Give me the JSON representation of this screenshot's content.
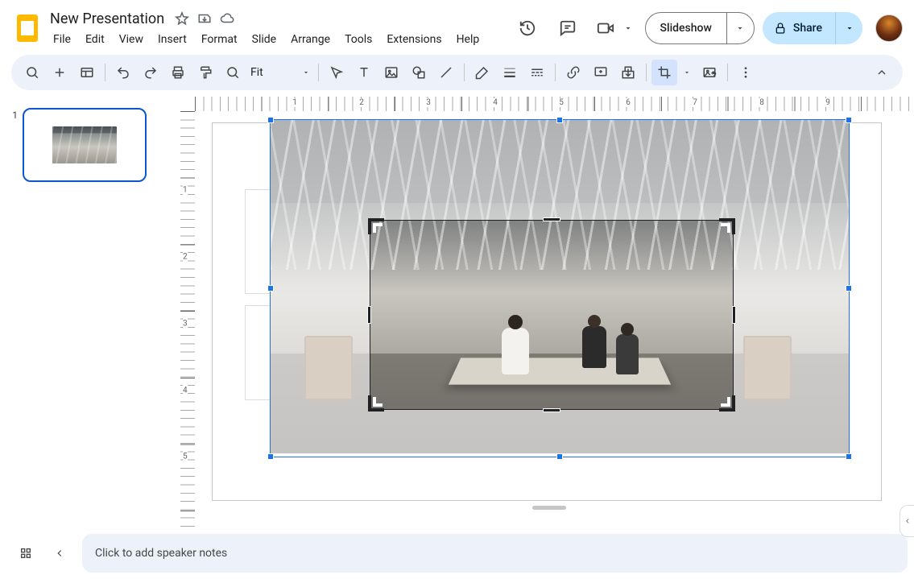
{
  "header": {
    "doc_title": "New Presentation",
    "menus": [
      "File",
      "Edit",
      "View",
      "Insert",
      "Format",
      "Slide",
      "Arrange",
      "Tools",
      "Extensions",
      "Help"
    ],
    "slideshow_label": "Slideshow",
    "share_label": "Share"
  },
  "toolbar": {
    "zoom_label": "Fit"
  },
  "filmstrip": {
    "slides": [
      {
        "number": "1"
      }
    ]
  },
  "ruler": {
    "h": [
      "1",
      "2",
      "3",
      "4",
      "5",
      "6",
      "7",
      "8",
      "9"
    ],
    "v": [
      "1",
      "2",
      "3",
      "4",
      "5"
    ]
  },
  "notes": {
    "placeholder": "Click to add speaker notes"
  },
  "colors": {
    "accent": "#0b57d0",
    "share_bg": "#c2e7ff",
    "toolbar_bg": "#edf2fa"
  }
}
